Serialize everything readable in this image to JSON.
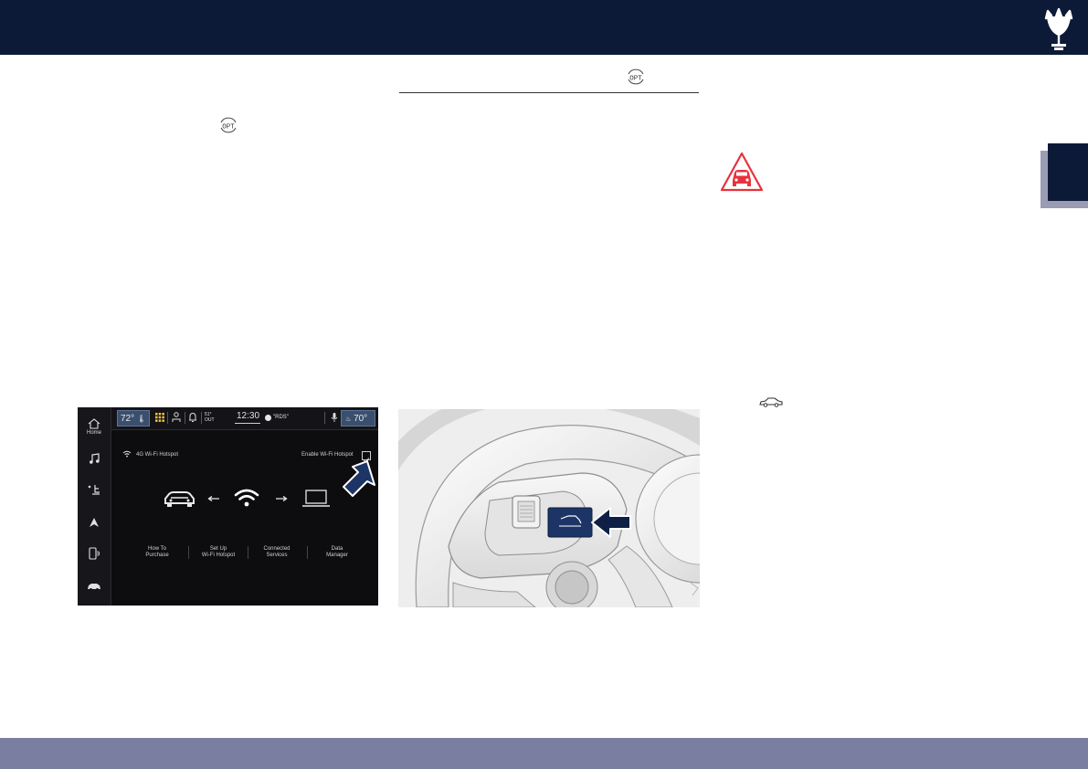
{
  "header": {
    "logo": "trident-logo"
  },
  "icons": {
    "opt": "opt-icon",
    "warning": "vehicle-warning-triangle-icon",
    "car": "car-side-icon"
  },
  "infotainment": {
    "temp_left": "72°",
    "temp_right": "70°",
    "outside_temp": "51°",
    "outside_label": "OUT",
    "time": "12:30",
    "station": "\"RDS\"",
    "sidebar_home": "Home",
    "hotspot_title": "4G Wi-Fi Hotspot",
    "enable_label": "Enable Wi-Fi Hotspot",
    "enable_checked": true,
    "menu": [
      {
        "line1": "How To",
        "line2": "Purchase"
      },
      {
        "line1": "Set Up",
        "line2": "Wi-Fi Hotspot"
      },
      {
        "line1": "Connected",
        "line2": "Services"
      },
      {
        "line1": "Data",
        "line2": "Manager"
      }
    ]
  },
  "colors": {
    "header": "#0c1a38",
    "footer": "#7a7ea0",
    "warning_red": "#e8323c",
    "accent_blue": "#1d3566"
  }
}
